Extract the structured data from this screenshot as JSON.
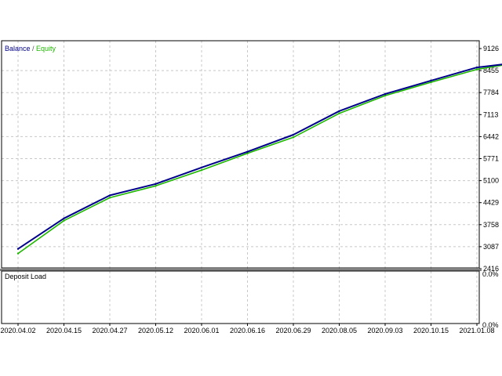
{
  "chart_data": {
    "type": "line",
    "legend": {
      "balance_label": "Balance",
      "separator": " / ",
      "equity_label": "Equity",
      "placement": "top-left"
    },
    "colors": {
      "balance": "#00008B",
      "equity": "#1FB800",
      "grid": "#c8c8c8",
      "axis": "#000000",
      "panel_divider": "#808080"
    },
    "grid": true,
    "y_axis": {
      "ticks": [
        "9126",
        "8455",
        "7784",
        "7113",
        "6442",
        "5771",
        "5100",
        "4429",
        "3758",
        "3087",
        "2416"
      ],
      "ylim": [
        2416,
        9126
      ]
    },
    "x_axis": {
      "labels": [
        "2020.04.02",
        "2020.04.15",
        "2020.04.27",
        "2020.05.12",
        "2020.06.01",
        "2020.06.16",
        "2020.06.29",
        "2020.08.05",
        "2020.09.03",
        "2020.10.15",
        "2021.01.08"
      ]
    },
    "series": [
      {
        "name": "Balance",
        "x": [
          0,
          1,
          2,
          3,
          4,
          5,
          6,
          7,
          8,
          9,
          10,
          10.6
        ],
        "values": [
          3020,
          3950,
          4650,
          5000,
          5500,
          5980,
          6500,
          7220,
          7740,
          8150,
          8550,
          8650
        ]
      },
      {
        "name": "Equity",
        "x": [
          0,
          1,
          2,
          3,
          4,
          5,
          6,
          7,
          8,
          9,
          10,
          10.6
        ],
        "values": [
          2880,
          3880,
          4580,
          4940,
          5420,
          5930,
          6420,
          7150,
          7690,
          8100,
          8490,
          8630
        ]
      }
    ],
    "deposit_load": {
      "title": "Deposit Load",
      "ticks": [
        "0.0%",
        "0.0%"
      ]
    }
  }
}
